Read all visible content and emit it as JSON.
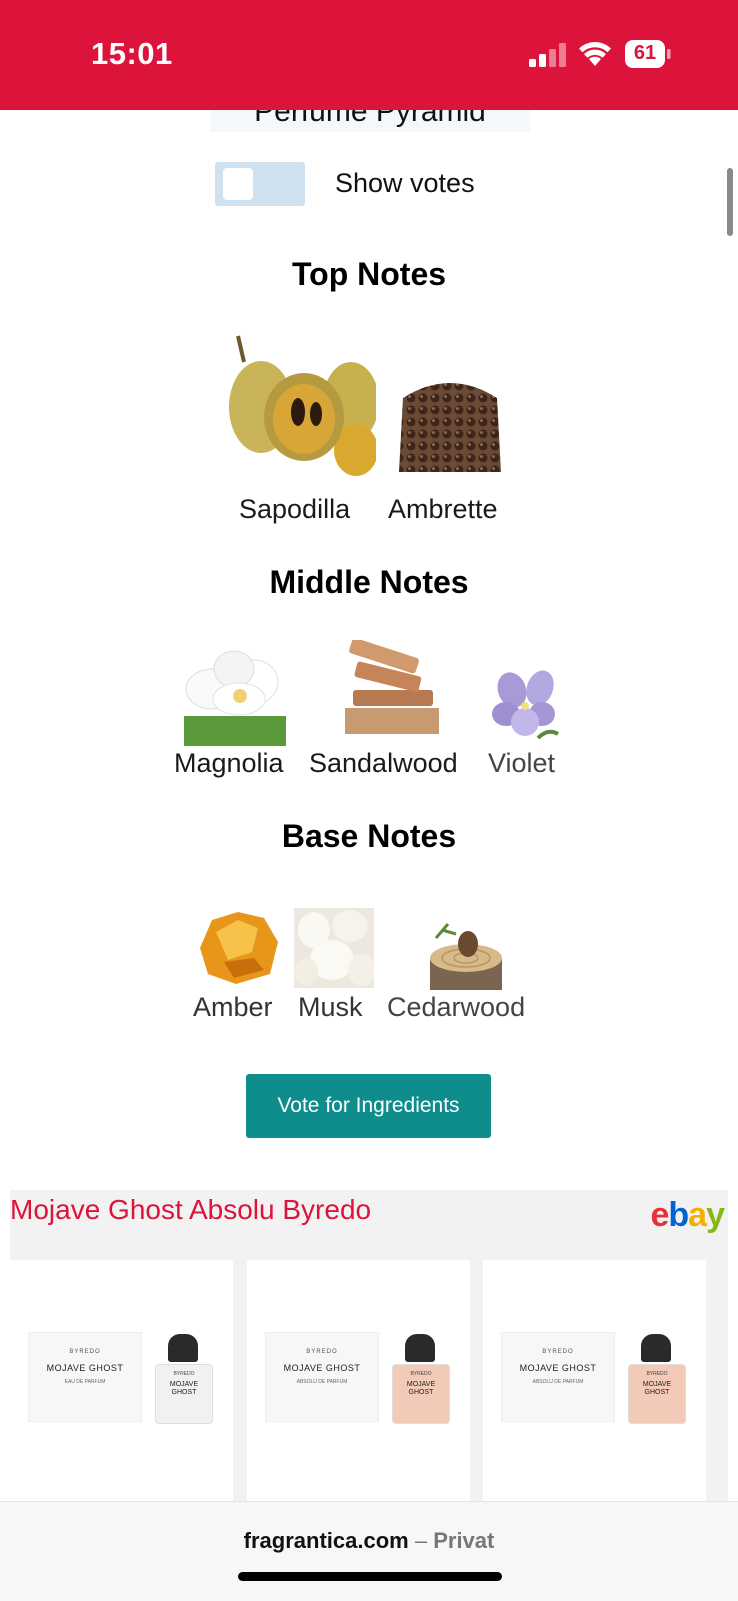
{
  "status_bar": {
    "time": "15:01",
    "battery": "61"
  },
  "page": {
    "pyramid_title": "Perfume Pyramid",
    "toggle_label": "Show votes",
    "sections": [
      {
        "title": "Top Notes",
        "notes": [
          {
            "label": "Sapodilla"
          },
          {
            "label": "Ambrette"
          }
        ]
      },
      {
        "title": "Middle Notes",
        "notes": [
          {
            "label": "Magnolia"
          },
          {
            "label": "Sandalwood"
          },
          {
            "label": "Violet"
          }
        ]
      },
      {
        "title": "Base Notes",
        "notes": [
          {
            "label": "Amber"
          },
          {
            "label": "Musk"
          },
          {
            "label": "Cedarwood"
          }
        ]
      }
    ],
    "vote_button": "Vote for Ingredients"
  },
  "ebay": {
    "title": "Mojave Ghost Absolu Byredo",
    "logo_letters": [
      "e",
      "b",
      "a",
      "y"
    ],
    "logo_colors": [
      "#e53238",
      "#0064d2",
      "#f5af02",
      "#86b817"
    ],
    "products": [
      {
        "brand": "BYREDO",
        "name": "MOJAVE GHOST",
        "sub": "EAU DE PARFUM",
        "bottle_brand": "BYREDO",
        "bottle_name": "MOJAVE GHOST",
        "cap_color": "#2a2a2a",
        "liquid_color": "#f1f1f1"
      },
      {
        "brand": "BYREDO",
        "name": "MOJAVE GHOST",
        "sub": "ABSOLU DE PARFUM",
        "bottle_brand": "BYREDO",
        "bottle_name": "MOJAVE GHOST",
        "cap_color": "#2a2a2a",
        "liquid_color": "#f3c9b8"
      },
      {
        "brand": "BYREDO",
        "name": "MOJAVE GHOST",
        "sub": "ABSOLU DE PARFUM",
        "bottle_brand": "BYREDO",
        "bottle_name": "MOJAVE GHOST",
        "cap_color": "#2a2a2a",
        "liquid_color": "#f3c9b8"
      }
    ]
  },
  "browser": {
    "domain": "fragrantica.com",
    "separator": "–",
    "mode": "Privat"
  }
}
